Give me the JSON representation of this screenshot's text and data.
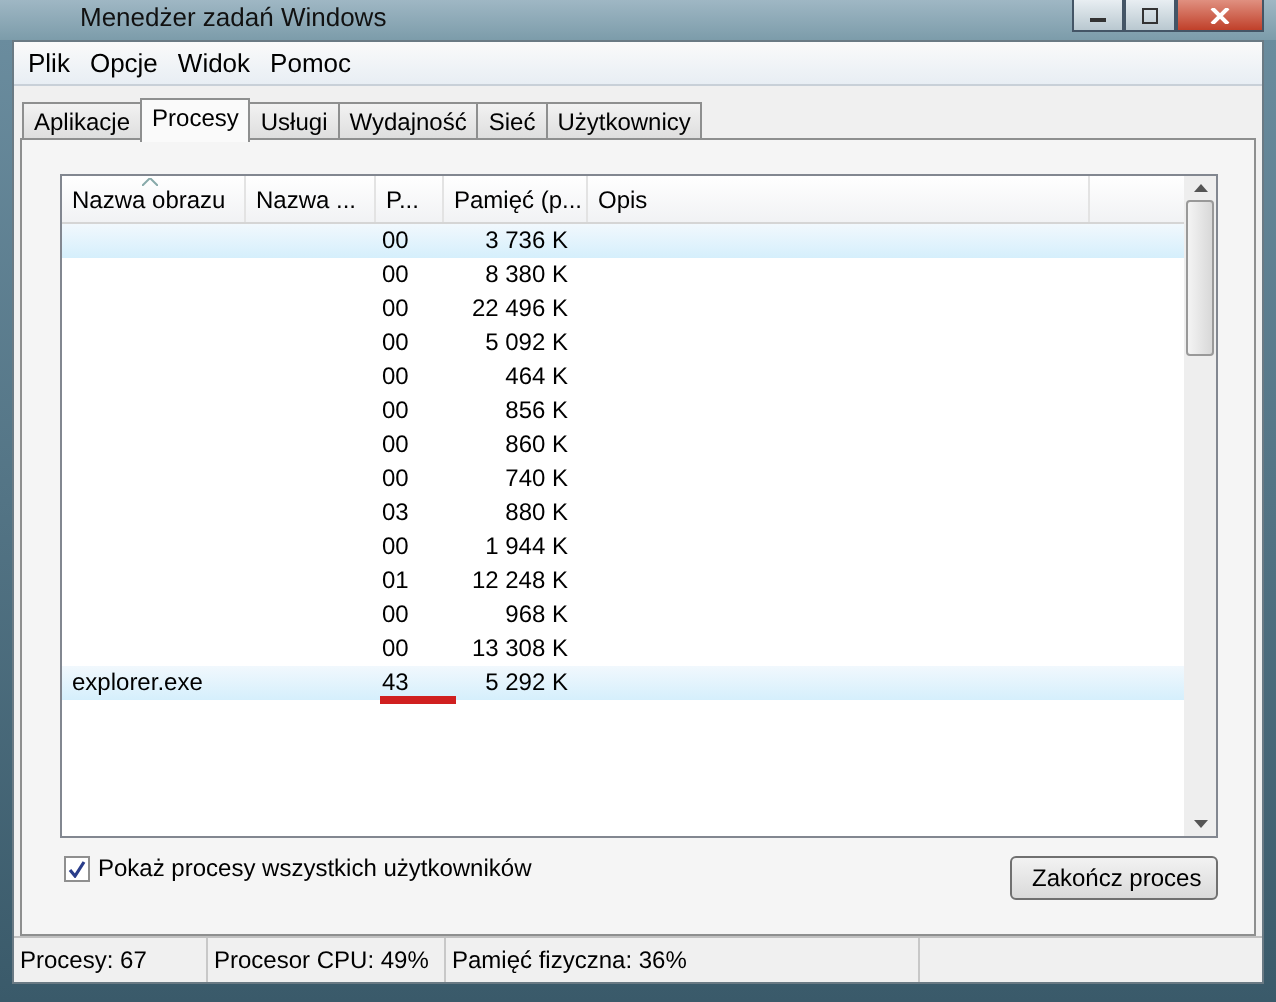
{
  "window": {
    "title": "Menedżer zadań Windows"
  },
  "menu": [
    "Plik",
    "Opcje",
    "Widok",
    "Pomoc"
  ],
  "tabs": [
    {
      "label": "Aplikacje",
      "selected": false
    },
    {
      "label": "Procesy",
      "selected": true
    },
    {
      "label": "Usługi",
      "selected": false
    },
    {
      "label": "Wydajność",
      "selected": false
    },
    {
      "label": "Sieć",
      "selected": false
    },
    {
      "label": "Użytkownicy",
      "selected": false
    }
  ],
  "table": {
    "columns": [
      "Nazwa obrazu",
      "Nazwa ...",
      "P...",
      "Pamięć (p...",
      "Opis"
    ],
    "rows": [
      {
        "cpu": "00",
        "memory": "3 736 K",
        "selected": true
      },
      {
        "cpu": "00",
        "memory": "8 380 K",
        "selected": false
      },
      {
        "cpu": "00",
        "memory": "22 496 K",
        "selected": false
      },
      {
        "cpu": "00",
        "memory": "5 092 K",
        "selected": false
      },
      {
        "cpu": "00",
        "memory": "464 K",
        "selected": false
      },
      {
        "cpu": "00",
        "memory": "856 K",
        "selected": false
      },
      {
        "cpu": "00",
        "memory": "860 K",
        "selected": false
      },
      {
        "cpu": "00",
        "memory": "740 K",
        "selected": false
      },
      {
        "cpu": "03",
        "memory": "880 K",
        "selected": false
      },
      {
        "cpu": "00",
        "memory": "1 944 K",
        "selected": false
      },
      {
        "cpu": "01",
        "memory": "12 248 K",
        "selected": false
      },
      {
        "cpu": "00",
        "memory": "968 K",
        "selected": false
      },
      {
        "cpu": "00",
        "memory": "13 308 K",
        "selected": false
      },
      {
        "name": "explorer.exe",
        "cpu": "43",
        "memory": "5 292 K",
        "selected": true
      }
    ]
  },
  "show_all": {
    "label": "Pokaż procesy wszystkich użytkowników",
    "checked": true
  },
  "end_button": "Zakończ proces",
  "status_bar": [
    "Procesy: 67",
    "Procesor CPU: 49%",
    "Pamięć fizyczna: 36%"
  ]
}
